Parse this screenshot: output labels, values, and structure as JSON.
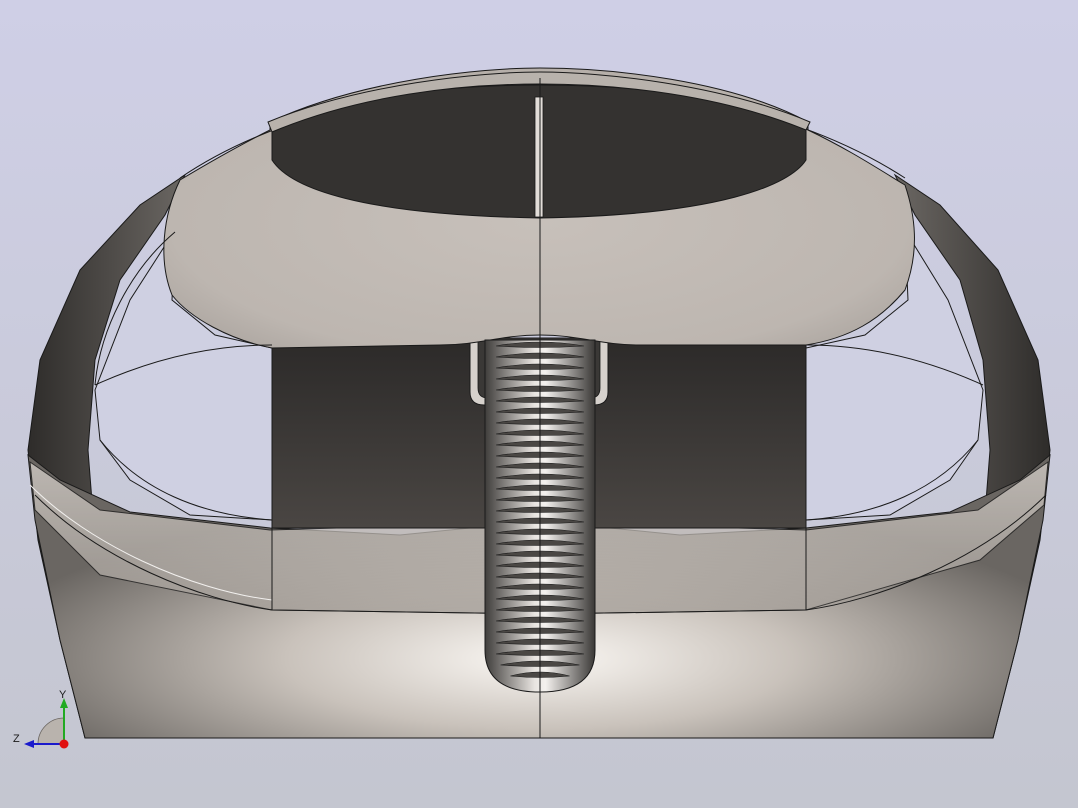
{
  "app": {
    "view": "cad-3d-viewport",
    "background_top": "#cfcfe4",
    "background_bottom": "#c6c8d2"
  },
  "model": {
    "shell_color": "#bdb6b0",
    "shadow_color": "#3a3836",
    "edge_color": "#1a1a1a"
  },
  "triad": {
    "y_label": "Y",
    "z_label": "Z",
    "x_color": "#e01010",
    "y_color": "#22aa22",
    "z_color": "#1a1acc",
    "icons": [
      "axis-triad-icon"
    ]
  }
}
